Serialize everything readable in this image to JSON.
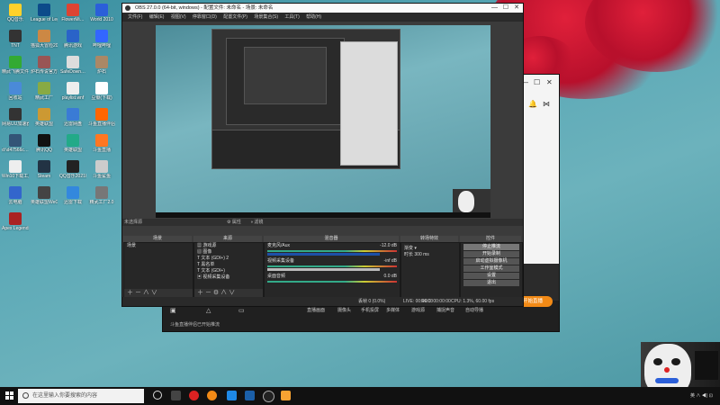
{
  "desktop": {
    "icons": [
      {
        "label": "QQ音乐",
        "color": "#ffd12b"
      },
      {
        "label": "League of Legends",
        "color": "#0c4b8a"
      },
      {
        "label": "FlowerMi…",
        "color": "#d43"
      },
      {
        "label": "World 2010",
        "color": "#2b5fd9"
      },
      {
        "label": "TNT",
        "color": "#333"
      },
      {
        "label": "猫狐大冒险2010游戏",
        "color": "#c84"
      },
      {
        "label": "腾讯游戏",
        "color": "#2a63c8"
      },
      {
        "label": "哔哩哔哩",
        "color": "#36f"
      },
      {
        "label": "精武飞腾文件",
        "color": "#3a3"
      },
      {
        "label": "炉石传说官方版",
        "color": "#955"
      },
      {
        "label": "SafeDown…",
        "color": "#ddd"
      },
      {
        "label": "炉石",
        "color": "#a86"
      },
      {
        "label": "回收站",
        "color": "#4a8ad8"
      },
      {
        "label": "精武工厂",
        "color": "#8a4"
      },
      {
        "label": "playlist.wnf",
        "color": "#eee"
      },
      {
        "label": "豆瓣(下载)",
        "color": "#fff"
      },
      {
        "label": "网易UU加速器",
        "color": "#333"
      },
      {
        "label": "英雄联盟",
        "color": "#c93"
      },
      {
        "label": "迅雷网盘",
        "color": "#3a7bd5"
      },
      {
        "label": "斗鱼直播伴侣",
        "color": "#f60"
      },
      {
        "label": "d:\\d47566c…",
        "color": "#357"
      },
      {
        "label": "腾讯QQ",
        "color": "#111"
      },
      {
        "label": "英雄联盟",
        "color": "#2a8"
      },
      {
        "label": "斗鱼直播",
        "color": "#f72"
      },
      {
        "label": "Win10下载工具",
        "color": "#eee"
      },
      {
        "label": "Steam",
        "color": "#234"
      },
      {
        "label": "QQ音乐20210603",
        "color": "#222"
      },
      {
        "label": "斗鱼鲨鱼",
        "color": "#ccc"
      },
      {
        "label": "云电脑",
        "color": "#36c"
      },
      {
        "label": "英雄联盟WeGame版",
        "color": "#444"
      },
      {
        "label": "迅雷下载",
        "color": "#38d"
      },
      {
        "label": "精武工厂2.0",
        "color": "#777"
      },
      {
        "label": "Apex Legends",
        "color": "#a22"
      }
    ]
  },
  "obs": {
    "title": "OBS 27.0.0 (64-bit, windows) - 配置文件: 未命名 - 场景: 未命名",
    "menu": [
      "文件(F)",
      "编辑(E)",
      "视图(V)",
      "停靠窗口(D)",
      "配置文件(P)",
      "场景集合(S)",
      "工具(T)",
      "帮助(H)"
    ],
    "source_selected": "未选择源",
    "source_props": "属性",
    "source_filters": "滤镜",
    "docks": {
      "scenes": {
        "title": "场景",
        "items": [
          "场景"
        ]
      },
      "sources": {
        "title": "来源",
        "items": [
          "游戏源",
          "图像",
          "文本 (GDI+) 2",
          "黑名单",
          "文本 (GDI+)",
          "视频采集设备"
        ]
      },
      "mixer": {
        "title": "混音器",
        "channels": [
          {
            "name": "麦克风/Aux",
            "db": "-12.0 dB"
          },
          {
            "name": "视频采集设备",
            "db": "-inf dB"
          },
          {
            "name": "桌面音频",
            "db": "0.0 dB"
          }
        ]
      },
      "transitions": {
        "title": "转场特效",
        "type": "渐变",
        "duration_label": "时长",
        "duration": "300 ms"
      },
      "controls": {
        "title": "控件",
        "buttons": [
          "停止推流",
          "开始录制",
          "启动虚拟摄像机",
          "工作室模式",
          "设置",
          "退出"
        ]
      }
    },
    "status": {
      "dropped": "丢帧 0 (0.0%)",
      "live": "LIVE: 00:00:00",
      "rec": "REC: 00:00:00",
      "cpu": "CPU: 1.3%, 60.00 fps"
    }
  },
  "streaming_app": {
    "tabs": [
      "直播画面",
      "摄像头",
      "手机投屏",
      "多媒体",
      "游戏源",
      "捕捉声音",
      "自动导播"
    ],
    "status_text": "斗鱼直播伴侣已开始推流",
    "live_button": "开始直播"
  },
  "taskbar": {
    "search_placeholder": "在这里输入你要搜索的内容",
    "tray_text": "英  ∧  ◀)  ⊡"
  },
  "colors": {
    "accent": "#f28a16",
    "obs_bg": "#3b3b3b",
    "desktop": "#5aa8b6"
  }
}
